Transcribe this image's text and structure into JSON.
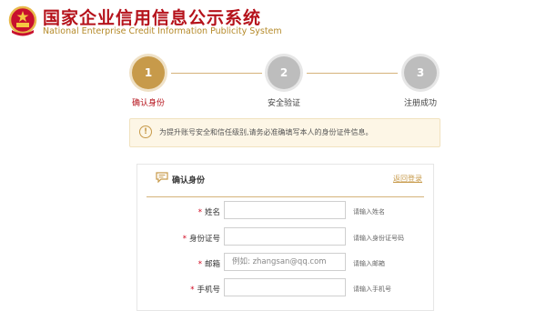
{
  "header": {
    "title_cn": "国家企业信用信息公示系统",
    "title_en": "National Enterprise Credit Information Publicity System",
    "emblem_icon": "national-emblem-icon"
  },
  "steps": [
    {
      "num": "1",
      "label": "确认身份",
      "active": true
    },
    {
      "num": "2",
      "label": "安全验证",
      "active": false
    },
    {
      "num": "3",
      "label": "注册成功",
      "active": false
    }
  ],
  "notice": {
    "icon": "exclamation-icon",
    "text": "为提升账号安全和信任级别,请务必准确填写本人的身份证件信息。"
  },
  "form": {
    "title": "确认身份",
    "link": "返回登录",
    "fields": [
      {
        "label": "姓名",
        "required": "*",
        "value": "",
        "placeholder": "",
        "hint": "请输入姓名"
      },
      {
        "label": "身份证号",
        "required": "*",
        "value": "",
        "placeholder": "",
        "hint": "请输入身份证号码"
      },
      {
        "label": "邮箱",
        "required": "*",
        "value": "",
        "placeholder": "例如: zhangsan@qq.com",
        "hint": "请输入邮箱"
      },
      {
        "label": "手机号",
        "required": "*",
        "value": "",
        "placeholder": "",
        "hint": "请输入手机号"
      }
    ]
  },
  "colors": {
    "brand_red": "#b5121b",
    "gold": "#c79a4a"
  }
}
